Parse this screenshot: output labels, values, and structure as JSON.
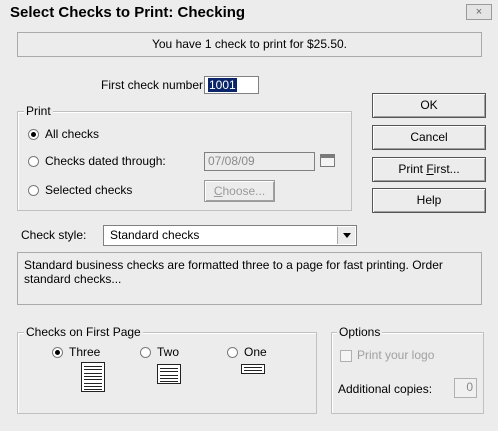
{
  "window": {
    "title": "Select Checks to Print: Checking",
    "close_symbol": "×"
  },
  "banner": "You have 1 check to print for $25.50.",
  "first_check": {
    "label": "First check number:",
    "value": "1001"
  },
  "print_group": {
    "title": "Print",
    "options": [
      {
        "label": "All checks",
        "selected": true
      },
      {
        "label": "Checks dated through:",
        "selected": false
      },
      {
        "label": "Selected checks",
        "selected": false
      }
    ],
    "date_value": "07/08/09",
    "choose_prefix": "C",
    "choose_rest": "hoose..."
  },
  "buttons": {
    "ok": "OK",
    "cancel": "Cancel",
    "print_first_prefix": "Print ",
    "print_first_mnemonic": "F",
    "print_first_rest": "irst...",
    "help": "Help"
  },
  "check_style": {
    "label": "Check style:",
    "value": "Standard checks"
  },
  "description": "Standard business checks are formatted three to a page for fast printing. Order standard checks...",
  "first_page_group": {
    "title": "Checks on First Page",
    "options": [
      {
        "label": "Three",
        "selected": true,
        "icon": "three-checks-icon"
      },
      {
        "label": "Two",
        "selected": false,
        "icon": "two-checks-icon"
      },
      {
        "label": "One",
        "selected": false,
        "icon": "one-check-icon"
      }
    ]
  },
  "options_group": {
    "title": "Options",
    "print_logo": "Print your logo",
    "additional_copies_label": "Additional copies:",
    "additional_copies_value": "0"
  }
}
